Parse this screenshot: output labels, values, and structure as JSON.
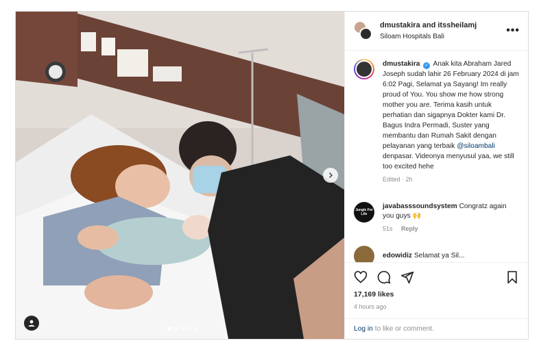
{
  "header": {
    "title": "dmustakira and itssheilamj",
    "location": "Siloam Hospitals Bali",
    "more_label": "•••"
  },
  "caption": {
    "username": "dmustakira",
    "text": "Anak kita Abraham Jared Joseph sudah lahir 26 February 2024 di jam 6:02 Pagi, Selamat ya Sayang! Im really proud of You. You show me how strong mother you are. Terima kasih untuk perhatian dan sigapnya Dokter kami Dr. Bagus Indra Permadi, Suster yang membantu dan Rumah Sakit dengan pelayanan yang terbaik",
    "mention": "@siloambali",
    "text_after": "denpasar. Videonya menyusul yaa, we still too excited hehe",
    "meta": "Edited · 2h"
  },
  "comments": [
    {
      "username": "javabasssoundsystem",
      "text": "Congratz again you guys 🙌",
      "time": "51s",
      "reply": "Reply",
      "avatar_text": "Jungle For Life"
    },
    {
      "username": "edowidiz",
      "text": "Selamat ya Sil..."
    }
  ],
  "actions": {
    "icons": [
      "heart-icon",
      "comment-icon",
      "share-icon",
      "save-icon"
    ],
    "likes": "17,169 likes",
    "time": "4 hours ago"
  },
  "login": {
    "link": "Log in",
    "text": "to like or comment."
  },
  "carousel": {
    "total": 5,
    "active_index": 0
  },
  "colors": {
    "link": "#00376b",
    "verified": "#3897f0",
    "muted": "#8e8e8e"
  }
}
